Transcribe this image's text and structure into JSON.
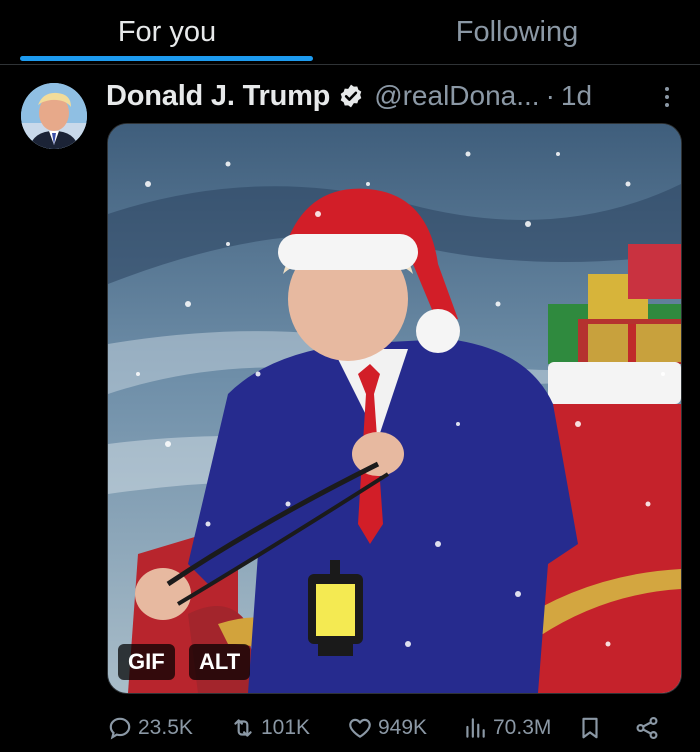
{
  "tabs": [
    {
      "label": "For you",
      "selected": true
    },
    {
      "label": "Following",
      "selected": false
    }
  ],
  "post": {
    "author_name": "Donald J. Trump",
    "handle": "@realDona...",
    "separator": "·",
    "time": "1d",
    "verified": true,
    "media_badges": {
      "gif": "GIF",
      "alt": "ALT"
    }
  },
  "actions": {
    "replies": "23.5K",
    "reposts": "101K",
    "likes": "949K",
    "views": "70.3M"
  },
  "colors": {
    "accent": "#1d9bf0",
    "background": "#000000",
    "secondary_text": "#8b98a5"
  },
  "icons": [
    "verified-badge-icon",
    "more-icon",
    "reply-icon",
    "repost-icon",
    "like-icon",
    "views-icon",
    "bookmark-icon",
    "share-icon"
  ]
}
